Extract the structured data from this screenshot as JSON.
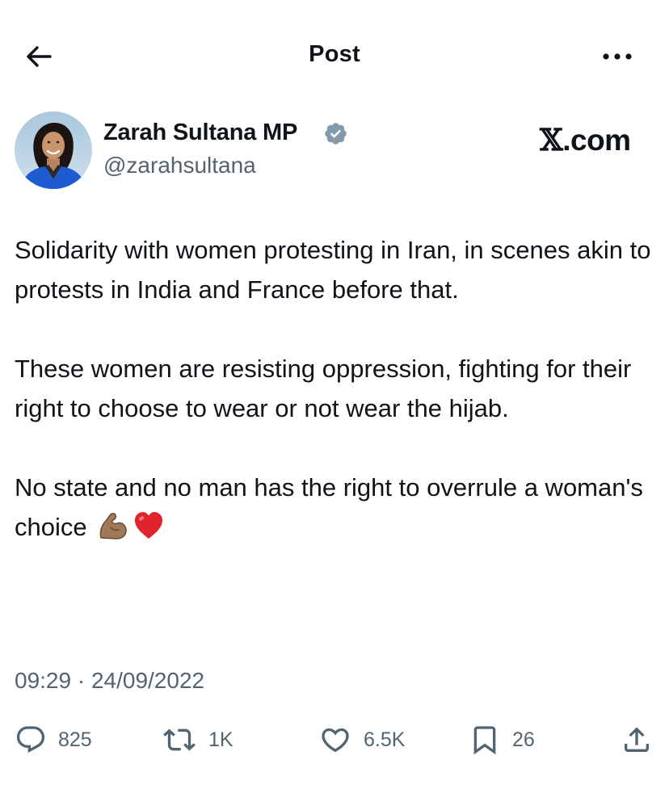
{
  "header": {
    "title": "Post",
    "back_icon": "arrow-left-icon",
    "more_icon": "more-horizontal-icon"
  },
  "author": {
    "name": "Zarah Sultana MP",
    "handle": "@zarahsultana",
    "verified": true,
    "verified_color": "#829aab"
  },
  "watermark": {
    "x_glyph": "𝕏",
    "domain": ".com"
  },
  "tweet": {
    "paragraphs": [
      "Solidarity with women protesting in Iran, in scenes akin to protests in India and France before that.",
      "These women are resisting oppression, fighting for their right to choose to wear or not wear the hijab.",
      "No state and no man has the right to overrule a woman's choice"
    ],
    "trailing_emojis": [
      "flexed-biceps-emoji",
      "red-heart-emoji"
    ]
  },
  "meta": {
    "timestamp": "09:29 · 24/09/2022"
  },
  "actions": {
    "replies": "825",
    "reposts": "1K",
    "likes": "6.5K",
    "bookmarks": "26"
  },
  "colors": {
    "text_primary": "#0f1419",
    "text_secondary": "#536471",
    "icon": "#536471",
    "background": "#ffffff"
  }
}
